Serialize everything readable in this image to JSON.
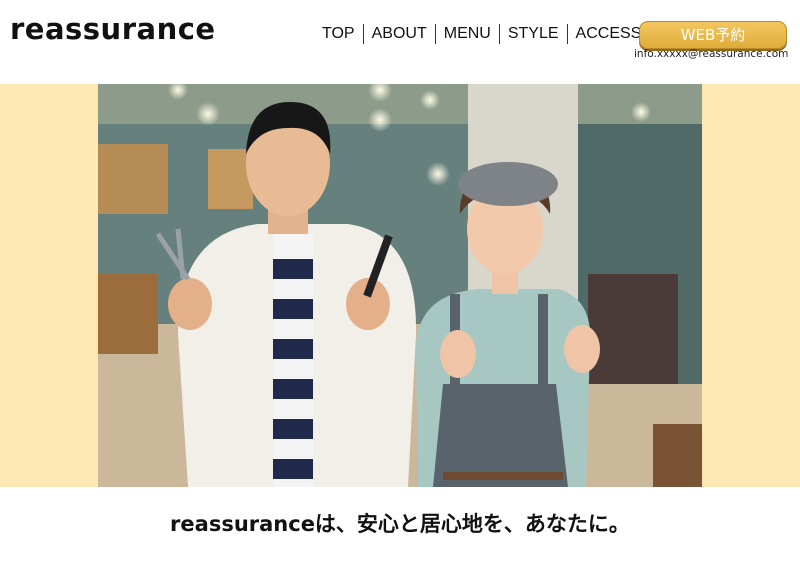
{
  "header": {
    "logo": "reassurance",
    "nav": [
      "TOP",
      "ABOUT",
      "MENU",
      "STYLE",
      "ACCESS"
    ],
    "reserve_label": "WEB予約",
    "email": "info.xxxxx@reassurance.com"
  },
  "hero": {
    "photo_icon": "salon-stylists-photo",
    "accent_color": "#fde7b3",
    "button_color": "#e9b94b"
  },
  "tagline": "reassuranceは、安心と居心地を、あなたに。"
}
